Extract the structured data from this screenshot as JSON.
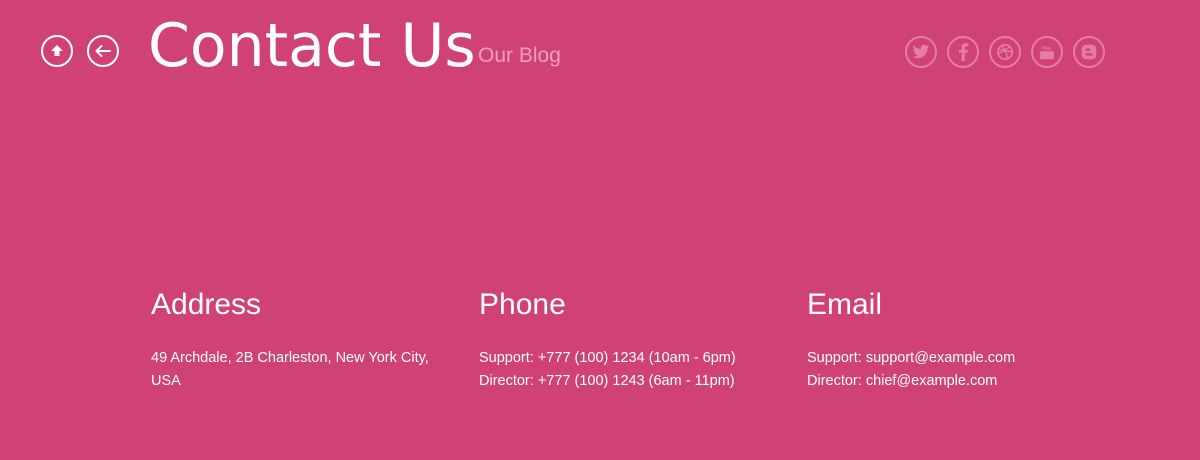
{
  "header": {
    "title": "Contact Us",
    "blog_link": "Our Blog",
    "home_icon": "home-up-arrow-icon",
    "back_icon": "back-arrow-icon"
  },
  "social": [
    {
      "name": "twitter",
      "icon": "twitter-icon"
    },
    {
      "name": "facebook",
      "icon": "facebook-icon"
    },
    {
      "name": "dribbble",
      "icon": "dribbble-icon"
    },
    {
      "name": "youtube",
      "icon": "youtube-icon"
    },
    {
      "name": "blogger",
      "icon": "blogger-icon"
    }
  ],
  "address": {
    "heading": "Address",
    "line1": "49 Archdale, 2B Charleston, New York City, USA"
  },
  "phone": {
    "heading": "Phone",
    "support": "Support: +777 (100) 1234 (10am - 6pm)",
    "director": "Director: +777 (100) 1243 (6am - 11pm)"
  },
  "email": {
    "heading": "Email",
    "support": "Support: support@example.com",
    "director": "Director: chief@example.com"
  },
  "colors": {
    "background": "#d04275",
    "muted": "#ee9fbd",
    "social_ring": "#e47ca3"
  }
}
